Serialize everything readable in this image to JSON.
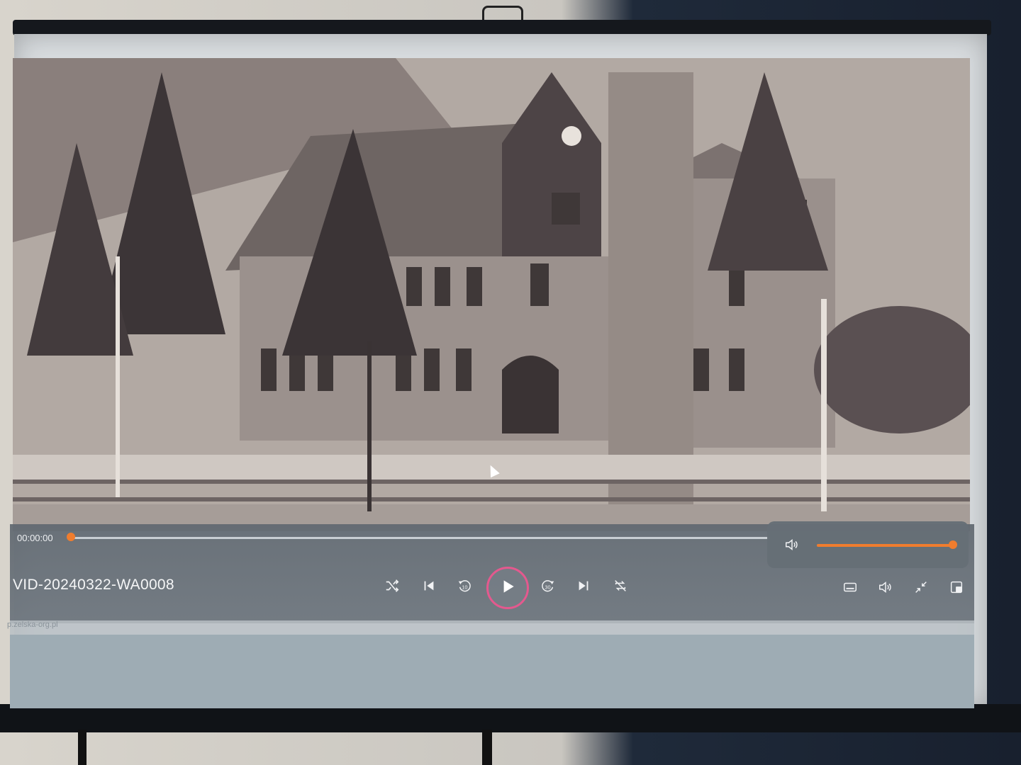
{
  "player": {
    "title": "VID-20240322-WA0008",
    "current_time": "00:00:00",
    "progress": 0,
    "volume": 1.0,
    "accent_color": "#f07d2e",
    "play_ring_color": "#e4598e"
  },
  "controls": {
    "shuffle_icon": "shuffle-icon",
    "previous_icon": "previous-icon",
    "rewind_icon": "rewind-10-icon",
    "rewind_label": "10",
    "play_icon": "play-icon",
    "forward_icon": "forward-30-icon",
    "forward_label": "30",
    "next_icon": "next-icon",
    "repeat_icon": "repeat-off-icon",
    "captions_icon": "captions-icon",
    "volume_icon": "volume-icon",
    "minimize_icon": "minimize-icon",
    "miniplayer_icon": "miniplayer-icon"
  },
  "overlay": {
    "watermark": "p.zelska-org.pl"
  }
}
